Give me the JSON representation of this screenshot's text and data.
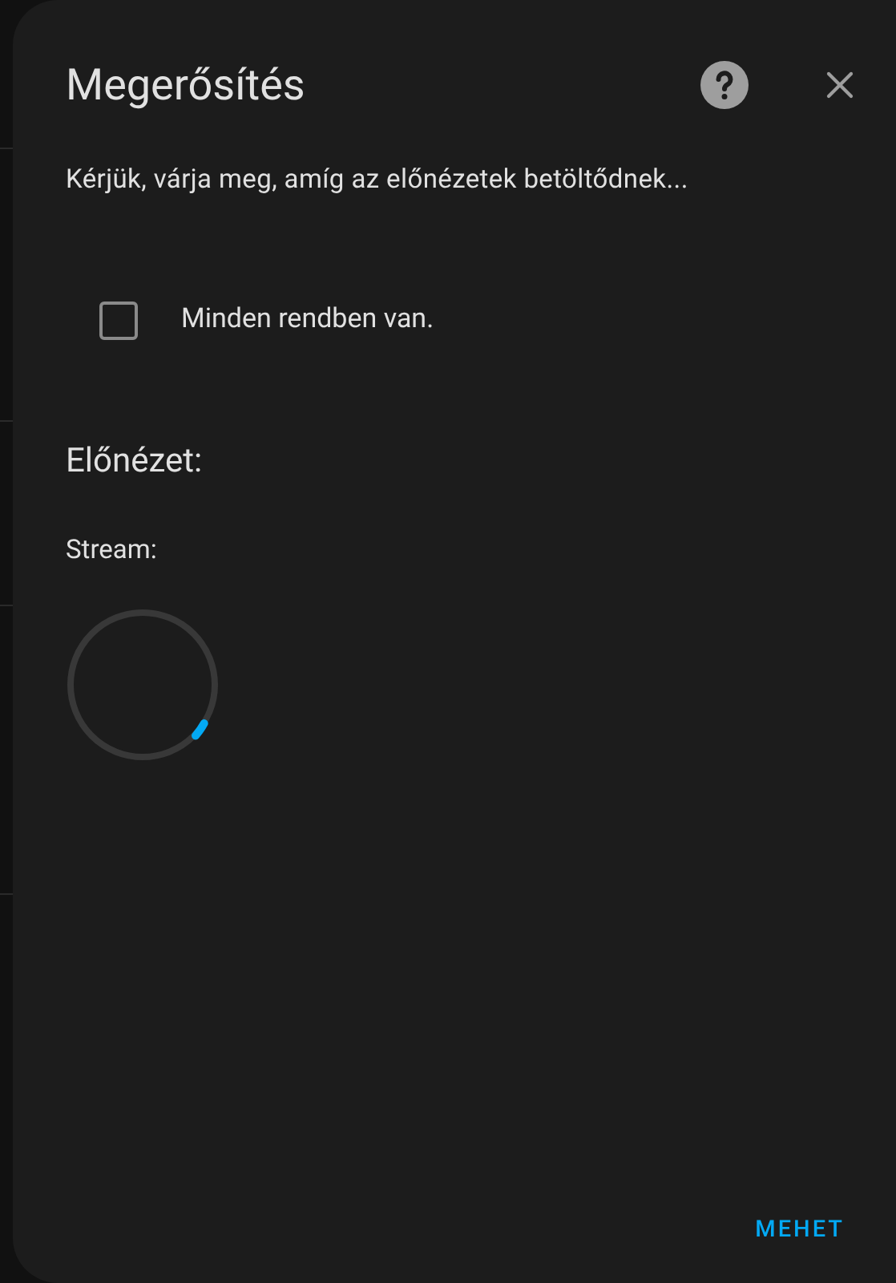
{
  "dialog": {
    "title": "Megerősítés",
    "message": "Kérjük, várja meg, amíg az előnézetek betöltődnek...",
    "checkbox": {
      "label": "Minden rendben van.",
      "checked": false
    },
    "preview_heading": "Előnézet:",
    "stream_label": "Stream:",
    "loading": true,
    "buttons": [
      "MEHET"
    ]
  }
}
